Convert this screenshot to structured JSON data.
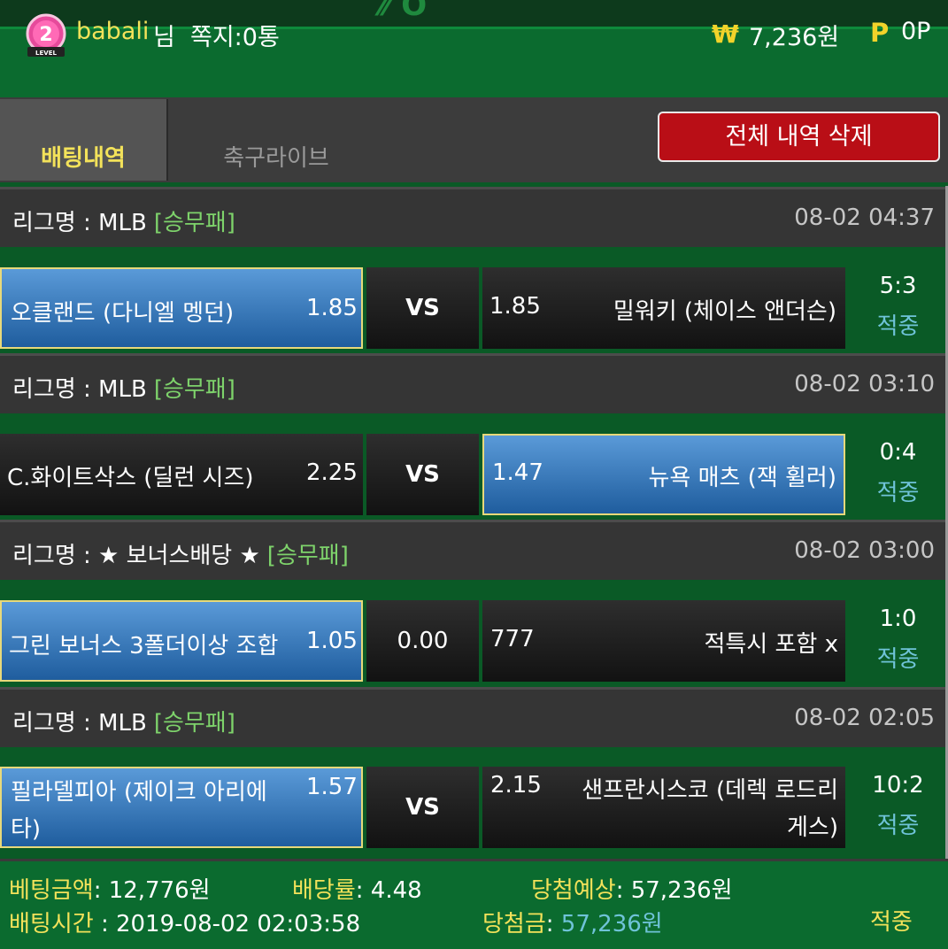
{
  "header": {
    "level": "2",
    "level_caption": "LEVEL",
    "username": "babali",
    "username_suffix": "님",
    "messages": "쪽지:0통",
    "balance": "7,236원",
    "points": "0P",
    "currency_icon": "won-icon",
    "point_icon": "p-icon"
  },
  "tabs": {
    "betting_history": "배팅내역",
    "soccer_live": "축구라이브",
    "delete_all": "전체 내역 삭제"
  },
  "bets": [
    {
      "league": "리그명 : MLB",
      "tag": "[승무패]",
      "time": "08-02 04:37",
      "home": "오클랜드 (다니엘 멩던)",
      "home_odds": "1.85",
      "middle": "VS",
      "away_odds": "1.85",
      "away": "밀워키 (체이스 앤더슨)",
      "score": "5:3",
      "status": "적중",
      "selected": "home"
    },
    {
      "league": "리그명 : MLB",
      "tag": "[승무패]",
      "time": "08-02 03:10",
      "home": "C.화이트삭스 (딜런 시즈)",
      "home_odds": "2.25",
      "middle": "VS",
      "away_odds": "1.47",
      "away": "뉴욕 매츠 (잭 휠러)",
      "score": "0:4",
      "status": "적중",
      "selected": "away"
    },
    {
      "league": "리그명 : ★ 보너스배당 ★",
      "tag": "[승무패]",
      "time": "08-02 03:00",
      "home": "그린 보너스 3폴더이상 조합",
      "home_odds": "1.05",
      "middle": "0.00",
      "away_odds": "777",
      "away": "적특시 포함 x",
      "score": "1:0",
      "status": "적중",
      "selected": "home"
    },
    {
      "league": "리그명 : MLB",
      "tag": "[승무패]",
      "time": "08-02 02:05",
      "home_line1": "필라델피아 (제이크 아리에",
      "home_line2": "타)",
      "home_odds": "1.57",
      "middle": "VS",
      "away_odds": "2.15",
      "away_line1": "샌프란시스코 (데렉 로드리",
      "away_line2": "게스)",
      "score": "10:2",
      "status": "적중",
      "selected": "home"
    }
  ],
  "summary": {
    "bet_amount_label": "베팅금액",
    "bet_amount": ": 12,776원",
    "odds_label": "배당률",
    "odds": ": 4.48",
    "expected_label": "당첨예상",
    "expected": ": 57,236원",
    "bet_time_label": "배팅시간",
    "bet_time": " : 2019-08-02 02:03:58",
    "payout_label": "당첨금",
    "payout_sep": ": ",
    "payout": "57,236원",
    "status": "적중"
  }
}
